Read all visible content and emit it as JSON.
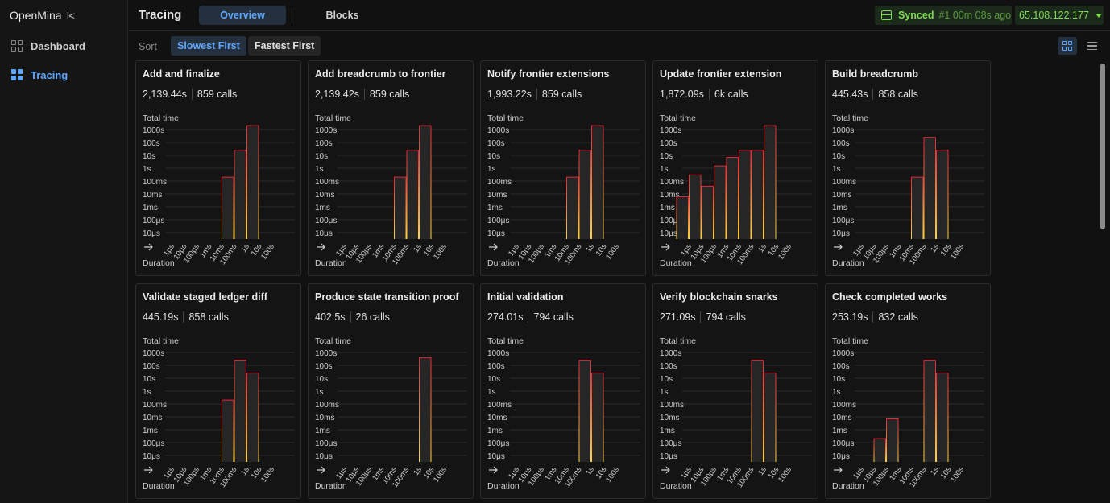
{
  "sidebar": {
    "brand": "OpenMina",
    "collapse_glyph": "I<",
    "items": [
      {
        "label": "Dashboard",
        "icon": "dashboard-icon",
        "active": false
      },
      {
        "label": "Tracing",
        "icon": "tracing-icon",
        "active": true
      }
    ]
  },
  "header": {
    "title": "Tracing",
    "tabs": [
      {
        "label": "Overview",
        "active": true
      },
      {
        "label": "Blocks",
        "active": false
      }
    ],
    "sync": {
      "status": "Synced",
      "block": "#1 00m 08s ago"
    },
    "node": "65.108.122.177"
  },
  "sort": {
    "label": "Sort",
    "options": [
      {
        "label": "Slowest First",
        "active": true
      },
      {
        "label": "Fastest First",
        "active": false
      }
    ]
  },
  "colors": {
    "accent": "#5fa8ff",
    "synced": "#7ddc52",
    "bar_fill": "#262626",
    "bar_edge_low": "#ffd33b",
    "bar_edge_high": "#e2283a"
  },
  "chart_data": [
    {
      "type": "bar",
      "title": "Add and finalize",
      "total": "2,139.44s",
      "calls": "859 calls",
      "ylabel": "Total time",
      "xlabel": "Duration",
      "y_ticks": [
        "1000s",
        "100s",
        "10s",
        "1s",
        "100ms",
        "10ms",
        "1ms",
        "100μs",
        "10μs"
      ],
      "x_ticks": [
        "1μs",
        "10μs",
        "100μs",
        "1ms",
        "10ms",
        "100ms",
        "1s",
        "10s",
        "100s"
      ],
      "y_scale": "log",
      "buckets": [
        "≤1μs",
        "1μs–10μs",
        "10μs–100μs",
        "100μs–1ms",
        "1ms–10ms",
        "10ms–100ms",
        "100ms–1s",
        "1s–10s",
        "10s–100s"
      ],
      "values_s": [
        0,
        0,
        0,
        0,
        0,
        0.2,
        25,
        2000,
        0
      ]
    },
    {
      "type": "bar",
      "title": "Add breadcrumb to frontier",
      "total": "2,139.42s",
      "calls": "859 calls",
      "ylabel": "Total time",
      "xlabel": "Duration",
      "y_ticks": [
        "1000s",
        "100s",
        "10s",
        "1s",
        "100ms",
        "10ms",
        "1ms",
        "100μs",
        "10μs"
      ],
      "x_ticks": [
        "1μs",
        "10μs",
        "100μs",
        "1ms",
        "10ms",
        "100ms",
        "1s",
        "10s",
        "100s"
      ],
      "y_scale": "log",
      "buckets": [
        "≤1μs",
        "1μs–10μs",
        "10μs–100μs",
        "100μs–1ms",
        "1ms–10ms",
        "10ms–100ms",
        "100ms–1s",
        "1s–10s",
        "10s–100s"
      ],
      "values_s": [
        0,
        0,
        0,
        0,
        0,
        0.2,
        25,
        2000,
        0
      ]
    },
    {
      "type": "bar",
      "title": "Notify frontier extensions",
      "total": "1,993.22s",
      "calls": "859 calls",
      "ylabel": "Total time",
      "xlabel": "Duration",
      "y_ticks": [
        "1000s",
        "100s",
        "10s",
        "1s",
        "100ms",
        "10ms",
        "1ms",
        "100μs",
        "10μs"
      ],
      "x_ticks": [
        "1μs",
        "10μs",
        "100μs",
        "1ms",
        "10ms",
        "100ms",
        "1s",
        "10s",
        "100s"
      ],
      "y_scale": "log",
      "buckets": [
        "≤1μs",
        "1μs–10μs",
        "10μs–100μs",
        "100μs–1ms",
        "1ms–10ms",
        "10ms–100ms",
        "100ms–1s",
        "1s–10s",
        "10s–100s"
      ],
      "values_s": [
        0,
        0,
        0,
        0,
        0,
        0.2,
        25,
        2000,
        0
      ]
    },
    {
      "type": "bar",
      "title": "Update frontier extension",
      "total": "1,872.09s",
      "calls": "6k calls",
      "ylabel": "Total time",
      "xlabel": "Duration",
      "y_ticks": [
        "1000s",
        "100s",
        "10s",
        "1s",
        "100ms",
        "10ms",
        "1ms",
        "100μs",
        "10μs"
      ],
      "x_ticks": [
        "1μs",
        "10μs",
        "100μs",
        "1ms",
        "10ms",
        "100ms",
        "1s",
        "10s",
        "100s"
      ],
      "y_scale": "log",
      "buckets": [
        "≤1μs",
        "1μs–10μs",
        "10μs–100μs",
        "100μs–1ms",
        "1ms–10ms",
        "10ms–100ms",
        "100ms–1s",
        "1s–10s",
        "10s–100s"
      ],
      "values_s": [
        0.006,
        0.3,
        0.04,
        1.5,
        7,
        25,
        25,
        2000,
        0
      ]
    },
    {
      "type": "bar",
      "title": "Build breadcrumb",
      "total": "445.43s",
      "calls": "858 calls",
      "ylabel": "Total time",
      "xlabel": "Duration",
      "y_ticks": [
        "1000s",
        "100s",
        "10s",
        "1s",
        "100ms",
        "10ms",
        "1ms",
        "100μs",
        "10μs"
      ],
      "x_ticks": [
        "1μs",
        "10μs",
        "100μs",
        "1ms",
        "10ms",
        "100ms",
        "1s",
        "10s",
        "100s"
      ],
      "y_scale": "log",
      "buckets": [
        "≤1μs",
        "1μs–10μs",
        "10μs–100μs",
        "100μs–1ms",
        "1ms–10ms",
        "10ms–100ms",
        "100ms–1s",
        "1s–10s",
        "10s–100s"
      ],
      "values_s": [
        0,
        0,
        0,
        0,
        0,
        0.2,
        250,
        25,
        0
      ]
    },
    {
      "type": "bar",
      "title": "Validate staged ledger diff",
      "total": "445.19s",
      "calls": "858 calls",
      "ylabel": "Total time",
      "xlabel": "Duration",
      "y_ticks": [
        "1000s",
        "100s",
        "10s",
        "1s",
        "100ms",
        "10ms",
        "1ms",
        "100μs",
        "10μs"
      ],
      "x_ticks": [
        "1μs",
        "10μs",
        "100μs",
        "1ms",
        "10ms",
        "100ms",
        "1s",
        "10s",
        "100s"
      ],
      "y_scale": "log",
      "buckets": [
        "≤1μs",
        "1μs–10μs",
        "10μs–100μs",
        "100μs–1ms",
        "1ms–10ms",
        "10ms–100ms",
        "100ms–1s",
        "1s–10s",
        "10s–100s"
      ],
      "values_s": [
        0,
        0,
        0,
        0,
        0,
        0.2,
        250,
        25,
        0
      ]
    },
    {
      "type": "bar",
      "title": "Produce state transition proof",
      "total": "402.5s",
      "calls": "26 calls",
      "ylabel": "Total time",
      "xlabel": "Duration",
      "y_ticks": [
        "1000s",
        "100s",
        "10s",
        "1s",
        "100ms",
        "10ms",
        "1ms",
        "100μs",
        "10μs"
      ],
      "x_ticks": [
        "1μs",
        "10μs",
        "100μs",
        "1ms",
        "10ms",
        "100ms",
        "1s",
        "10s",
        "100s"
      ],
      "y_scale": "log",
      "buckets": [
        "≤1μs",
        "1μs–10μs",
        "10μs–100μs",
        "100μs–1ms",
        "1ms–10ms",
        "10ms–100ms",
        "100ms–1s",
        "1s–10s",
        "10s–100s"
      ],
      "values_s": [
        0,
        0,
        0,
        0,
        0,
        0,
        0,
        400,
        0
      ]
    },
    {
      "type": "bar",
      "title": "Initial validation",
      "total": "274.01s",
      "calls": "794 calls",
      "ylabel": "Total time",
      "xlabel": "Duration",
      "y_ticks": [
        "1000s",
        "100s",
        "10s",
        "1s",
        "100ms",
        "10ms",
        "1ms",
        "100μs",
        "10μs"
      ],
      "x_ticks": [
        "1μs",
        "10μs",
        "100μs",
        "1ms",
        "10ms",
        "100ms",
        "1s",
        "10s",
        "100s"
      ],
      "y_scale": "log",
      "buckets": [
        "≤1μs",
        "1μs–10μs",
        "10μs–100μs",
        "100μs–1ms",
        "1ms–10ms",
        "10ms–100ms",
        "100ms–1s",
        "1s–10s",
        "10s–100s"
      ],
      "values_s": [
        0,
        0,
        0,
        0,
        0,
        0,
        250,
        25,
        0
      ]
    },
    {
      "type": "bar",
      "title": "Verify blockchain snarks",
      "total": "271.09s",
      "calls": "794 calls",
      "ylabel": "Total time",
      "xlabel": "Duration",
      "y_ticks": [
        "1000s",
        "100s",
        "10s",
        "1s",
        "100ms",
        "10ms",
        "1ms",
        "100μs",
        "10μs"
      ],
      "x_ticks": [
        "1μs",
        "10μs",
        "100μs",
        "1ms",
        "10ms",
        "100ms",
        "1s",
        "10s",
        "100s"
      ],
      "y_scale": "log",
      "buckets": [
        "≤1μs",
        "1μs–10μs",
        "10μs–100μs",
        "100μs–1ms",
        "1ms–10ms",
        "10ms–100ms",
        "100ms–1s",
        "1s–10s",
        "10s–100s"
      ],
      "values_s": [
        0,
        0,
        0,
        0,
        0,
        0,
        250,
        25,
        0
      ]
    },
    {
      "type": "bar",
      "title": "Check completed works",
      "total": "253.19s",
      "calls": "832 calls",
      "ylabel": "Total time",
      "xlabel": "Duration",
      "y_ticks": [
        "1000s",
        "100s",
        "10s",
        "1s",
        "100ms",
        "10ms",
        "1ms",
        "100μs",
        "10μs"
      ],
      "x_ticks": [
        "1μs",
        "10μs",
        "100μs",
        "1ms",
        "10ms",
        "100ms",
        "1s",
        "10s",
        "100s"
      ],
      "y_scale": "log",
      "buckets": [
        "≤1μs",
        "1μs–10μs",
        "10μs–100μs",
        "100μs–1ms",
        "1ms–10ms",
        "10ms–100ms",
        "100ms–1s",
        "1s–10s",
        "10s–100s"
      ],
      "values_s": [
        0,
        0,
        0.0002,
        0.007,
        0,
        0,
        250,
        25,
        0
      ]
    }
  ]
}
